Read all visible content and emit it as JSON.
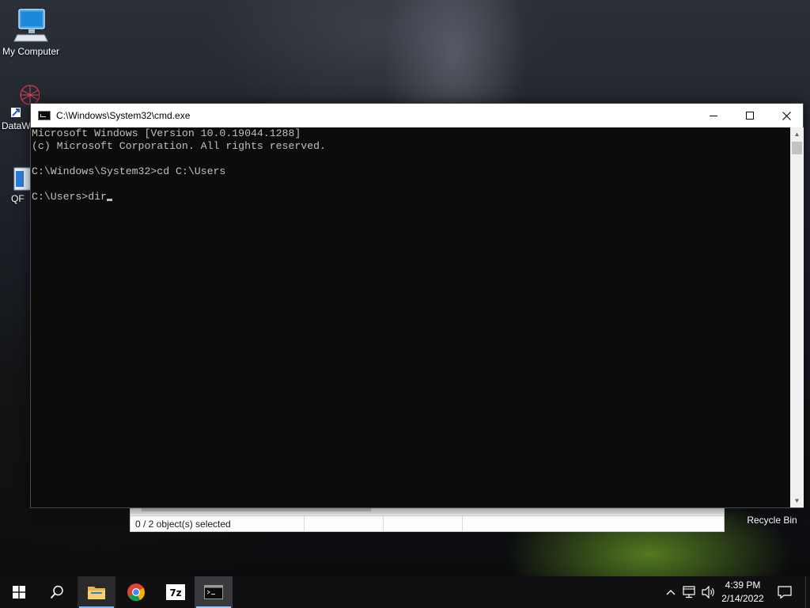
{
  "desktop": {
    "icons": [
      {
        "label": "My Computer"
      },
      {
        "label": "DataW"
      },
      {
        "label": "QF"
      },
      {
        "label": "Recycle Bin"
      }
    ]
  },
  "explorer": {
    "status_text": "0 / 2 object(s) selected"
  },
  "cmd": {
    "title": "C:\\Windows\\System32\\cmd.exe",
    "lines": [
      "Microsoft Windows [Version 10.0.19044.1288]",
      "(c) Microsoft Corporation. All rights reserved.",
      "",
      "C:\\Windows\\System32>cd C:\\Users",
      "",
      "C:\\Users>dir"
    ],
    "controls": {
      "minimize": "minimize-icon",
      "maximize": "maximize-icon",
      "close": "close-icon"
    }
  },
  "taskbar": {
    "items": [
      "windows-start-icon",
      "search-icon",
      "file-explorer-icon",
      "chrome-icon",
      "7zip-icon",
      "cmd-icon"
    ],
    "tray": {
      "icons": [
        "chevron-up-icon",
        "network-icon",
        "volume-icon"
      ]
    },
    "clock": {
      "time": "4:39 PM",
      "date": "2/14/2022"
    },
    "notifications": "notification-icon"
  }
}
